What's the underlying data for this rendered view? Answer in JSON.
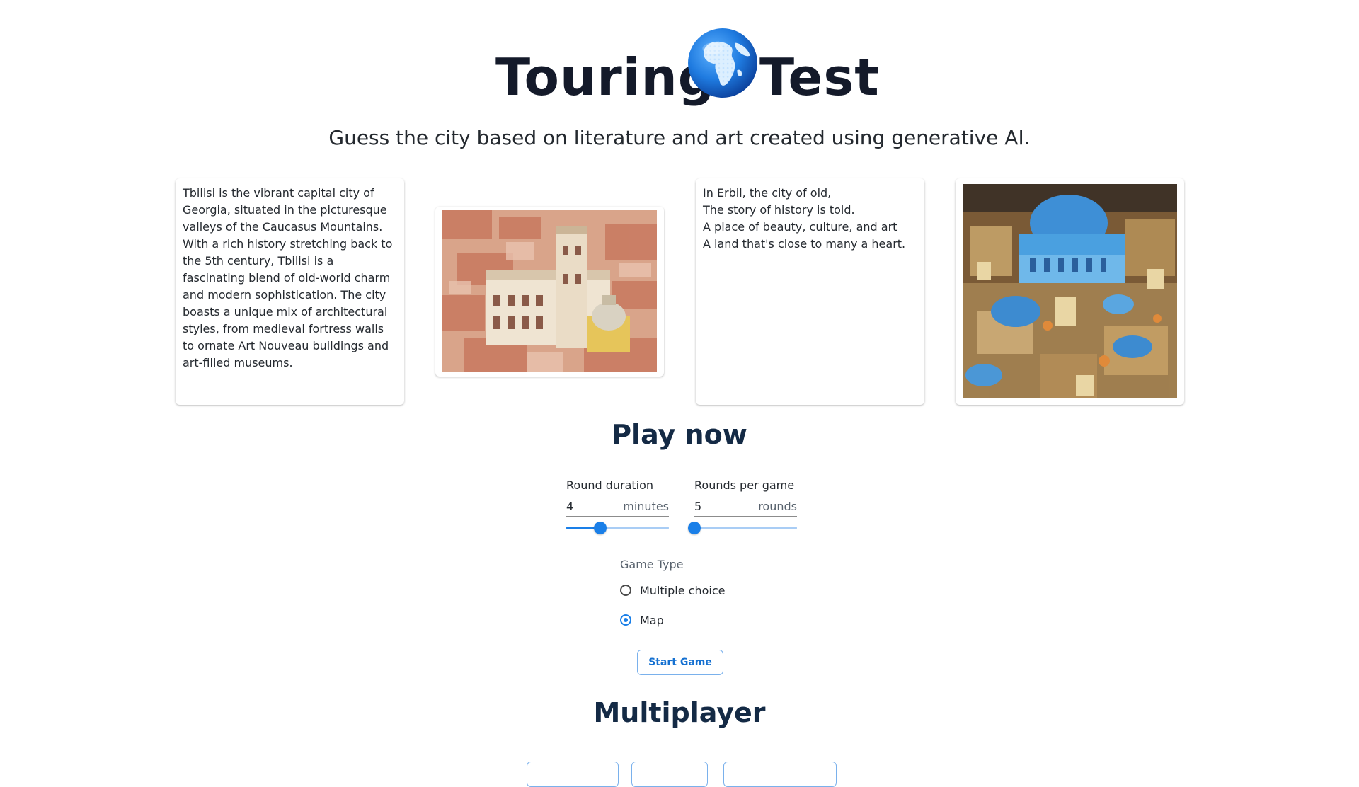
{
  "header": {
    "title_left": "Touring",
    "title_right": "Test",
    "globe_icon": "globe-icon",
    "subtitle": "Guess the city based on literature and art created using generative AI."
  },
  "cards": {
    "tbilisi_text": "Tbilisi is the vibrant capital city of Georgia, situated in the picturesque valleys of the Caucasus Mountains. With a rich history stretching back to the 5th century, Tbilisi is a fascinating blend of old-world charm and modern sophistication. The city boasts a unique mix of architectural styles, from medieval fortress walls to ornate Art Nouveau buildings and art-filled museums.",
    "erbil_poem": "In Erbil, the city of old,\nThe story of history is told.\nA place of beauty, culture, and art\nA land that's close to many a heart."
  },
  "play": {
    "title": "Play now",
    "round_duration": {
      "label": "Round duration",
      "value": "4",
      "unit": "minutes",
      "fraction": 0.33
    },
    "rounds_per_game": {
      "label": "Rounds per game",
      "value": "5",
      "unit": "rounds",
      "fraction": 0.0
    },
    "game_type": {
      "label": "Game Type",
      "options": [
        "Multiple choice",
        "Map"
      ],
      "selected": "Map"
    },
    "start_label": "Start Game"
  },
  "multiplayer": {
    "title": "Multiplayer"
  },
  "colors": {
    "accent": "#1a7fe8",
    "heading": "#142a45"
  }
}
